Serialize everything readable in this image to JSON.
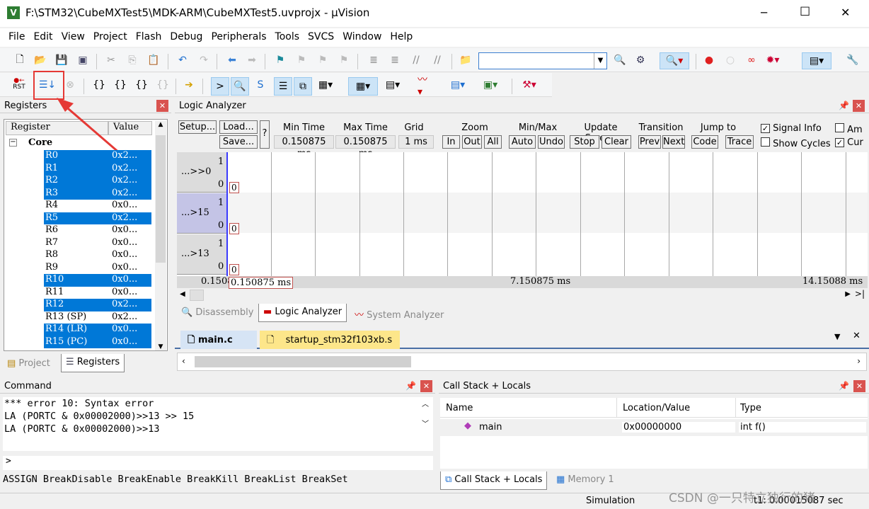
{
  "window": {
    "title": "F:\\STM32\\CubeMXTest5\\MDK-ARM\\CubeMXTest5.uvprojx - µVision",
    "minimize": "─",
    "maximize": "☐",
    "close": "✕"
  },
  "menu": [
    "File",
    "Edit",
    "View",
    "Project",
    "Flash",
    "Debug",
    "Peripherals",
    "Tools",
    "SVCS",
    "Window",
    "Help"
  ],
  "toolbar2": {
    "reset_label": "RST"
  },
  "registers": {
    "title": "Registers",
    "col_register": "Register",
    "col_value": "Value",
    "group": "Core",
    "rows": [
      {
        "name": "R0",
        "value": "0x2...",
        "selected": true
      },
      {
        "name": "R1",
        "value": "0x2...",
        "selected": true
      },
      {
        "name": "R2",
        "value": "0x2...",
        "selected": true
      },
      {
        "name": "R3",
        "value": "0x2...",
        "selected": true
      },
      {
        "name": "R4",
        "value": "0x0...",
        "selected": false
      },
      {
        "name": "R5",
        "value": "0x2...",
        "selected": true
      },
      {
        "name": "R6",
        "value": "0x0...",
        "selected": false
      },
      {
        "name": "R7",
        "value": "0x0...",
        "selected": false
      },
      {
        "name": "R8",
        "value": "0x0...",
        "selected": false
      },
      {
        "name": "R9",
        "value": "0x0...",
        "selected": false
      },
      {
        "name": "R10",
        "value": "0x0...",
        "selected": true
      },
      {
        "name": "R11",
        "value": "0x0...",
        "selected": false
      },
      {
        "name": "R12",
        "value": "0x2...",
        "selected": true
      },
      {
        "name": "R13 (SP)",
        "value": "0x2...",
        "selected": false
      },
      {
        "name": "R14 (LR)",
        "value": "0x0...",
        "selected": true
      },
      {
        "name": "R15 (PC)",
        "value": "0x0...",
        "selected": true
      }
    ],
    "tabs": [
      "Project",
      "Registers"
    ]
  },
  "logic_analyzer": {
    "title": "Logic Analyzer",
    "buttons": {
      "setup": "Setup...",
      "load": "Load...",
      "save": "Save...",
      "help": "?",
      "in": "In",
      "out": "Out",
      "all": "All",
      "auto": "Auto",
      "undo": "Undo",
      "stop": "Stop",
      "clear": "Clear",
      "prev": "Prev",
      "next": "Next",
      "code": "Code",
      "trace": "Trace"
    },
    "labels": {
      "min_time": "Min Time",
      "max_time": "Max Time",
      "grid": "Grid",
      "zoom": "Zoom",
      "minmax": "Min/Max",
      "update": "Update Screen",
      "transition": "Transition",
      "jump": "Jump to"
    },
    "values": {
      "min_time": "0.150875 ms",
      "max_time": "0.150875 ms",
      "grid": "1 ms"
    },
    "checkboxes": [
      {
        "label": "Signal Info",
        "checked": true
      },
      {
        "label": "Show Cycles",
        "checked": false
      },
      {
        "label": "Am",
        "checked": false
      },
      {
        "label": "Cur",
        "checked": true
      }
    ],
    "signals": [
      {
        "name": "...>>0",
        "high": "1",
        "low": "0",
        "value": "0"
      },
      {
        "name": "...>15",
        "high": "1",
        "low": "0",
        "value": "0"
      },
      {
        "name": "...>13",
        "high": "1",
        "low": "0",
        "value": "0"
      }
    ],
    "axis": {
      "left": "0.1508",
      "cursor": "0.150875 ms",
      "mid": "7.150875 ms",
      "right": "14.15088 ms"
    },
    "tabs": [
      "Disassembly",
      "Logic Analyzer",
      "System Analyzer"
    ]
  },
  "editor": {
    "tabs": [
      "main.c",
      "startup_stm32f103xb.s"
    ]
  },
  "command": {
    "title": "Command",
    "lines": [
      "*** error 10: Syntax error",
      "LA (PORTC & 0x00002000)>>13 >> 15",
      "LA (PORTC & 0x00002000)>>13"
    ],
    "prompt": ">",
    "hint": "ASSIGN BreakDisable BreakEnable BreakKill BreakList BreakSet"
  },
  "callstack": {
    "title": "Call Stack + Locals",
    "columns": [
      "Name",
      "Location/Value",
      "Type"
    ],
    "rows": [
      {
        "name": "main",
        "value": "0x00000000",
        "type": "int f()"
      }
    ],
    "tabs": [
      "Call Stack + Locals",
      "Memory 1"
    ]
  },
  "status": {
    "mode": "Simulation",
    "time": "t1: 0.00015087 sec",
    "watermark": "CSDN @一只特立独行的猪"
  },
  "colors": {
    "selection": "#0078d7",
    "annotation": "#e53935",
    "cursor": "#3a3aff"
  }
}
